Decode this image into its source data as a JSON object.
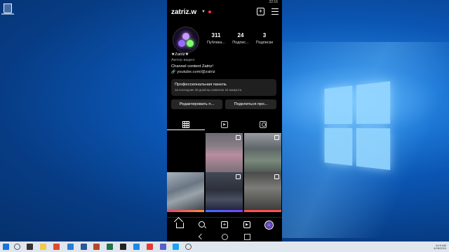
{
  "window": {
    "status_time": "22:16"
  },
  "profile": {
    "username": "zatriz.w",
    "stats": [
      {
        "value": "311",
        "label": "Публика..."
      },
      {
        "value": "24",
        "label": "Подпис..."
      },
      {
        "value": "3",
        "label": "Подписки"
      }
    ],
    "bio": {
      "name": "★Zatriz★",
      "category": "Автор видео",
      "text": "Channel content Zatriz!",
      "link": "youtube.com/@zatriz"
    },
    "pro_panel": {
      "title": "Профессиональная панель",
      "subtitle": "За последние 30 дней вы охватили 23 аккаунта."
    },
    "buttons": {
      "edit": "Редактировать п...",
      "share": "Поделиться про..."
    }
  },
  "icons": {
    "header": [
      "chevron-down-icon",
      "new-post-icon",
      "menu-icon"
    ],
    "tabs": [
      "grid-icon",
      "reels-icon",
      "tagged-icon"
    ],
    "bottom_nav": [
      "home-icon",
      "search-icon",
      "create-icon",
      "reels-icon",
      "profile-icon"
    ]
  },
  "colors": {
    "notification_dot": "#ff3040",
    "phone_bg": "#000000",
    "panel_bg": "#1f1f1f",
    "button_bg": "#262626"
  },
  "taskbar": {
    "tray_time": "8:19 AM",
    "tray_date": "4/26/2024"
  }
}
